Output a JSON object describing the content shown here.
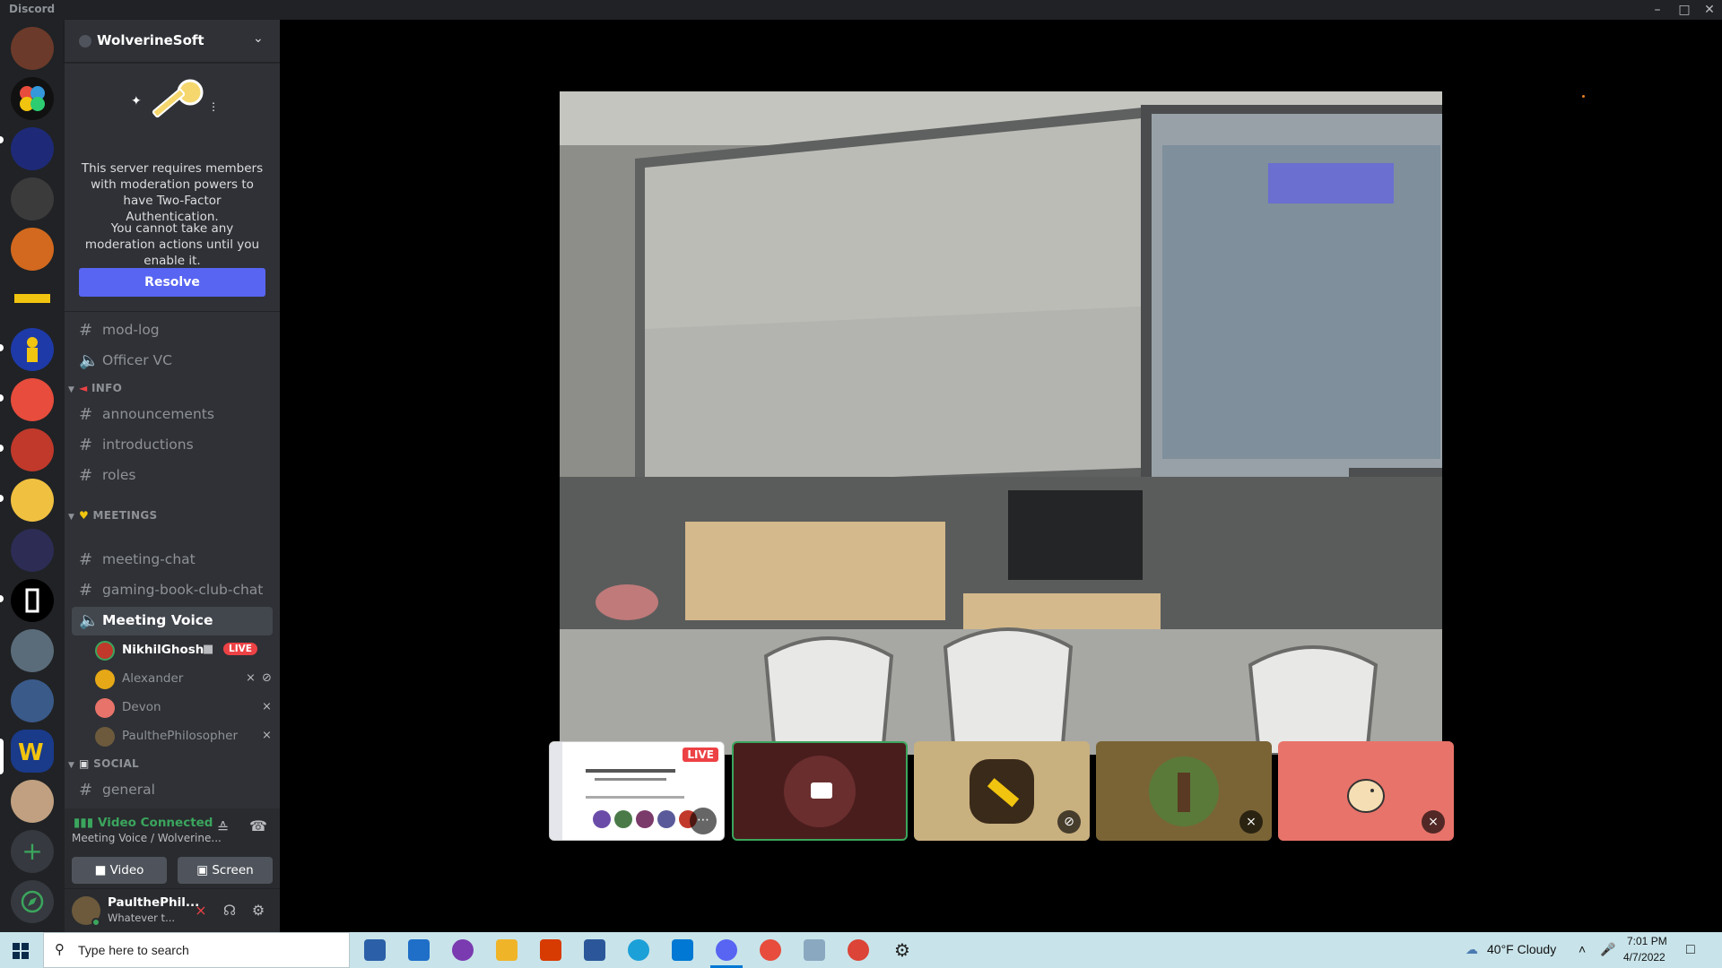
{
  "window": {
    "app_name": "Discord"
  },
  "server": {
    "name": "WolverineSoft",
    "notice": {
      "line1": "This server requires members with moderation powers to have Two-Factor Authentication.",
      "line2": "You cannot take any moderation actions until you enable it.",
      "resolve_label": "Resolve"
    }
  },
  "channels": {
    "top": [
      {
        "type": "text",
        "name": "mod-log"
      },
      {
        "type": "voice",
        "name": "Officer VC"
      }
    ],
    "info_category": "INFO",
    "info": [
      "announcements",
      "introductions",
      "roles"
    ],
    "meetings_category": "MEETINGS",
    "meetings": [
      "meeting-chat",
      "gaming-book-club-chat"
    ],
    "voice_active": "Meeting Voice",
    "social_category": "SOCIAL",
    "social": [
      "general"
    ]
  },
  "voice_users": [
    {
      "name": "NikhilGhosh",
      "live_label": "LIVE",
      "color": "#c0392b"
    },
    {
      "name": "Alexander",
      "color": "#e6a817"
    },
    {
      "name": "Devon",
      "color": "#e8736a"
    },
    {
      "name": "PaulthePhilosopher",
      "color": "#6d5a3c"
    }
  ],
  "voice_panel": {
    "status": "Video Connected",
    "location": "Meeting Voice / Wolverine...",
    "video_label": "Video",
    "screen_label": "Screen"
  },
  "user": {
    "name": "PaulthePhil...",
    "status": "Whatever t..."
  },
  "stream_tiles": [
    {
      "kind": "screen",
      "live_label": "LIVE",
      "bg": "#ffffff"
    },
    {
      "kind": "camera",
      "bg": "#4a1d1d"
    },
    {
      "kind": "avatar",
      "bg": "#c9b07f"
    },
    {
      "kind": "avatar",
      "bg": "#7a6436"
    },
    {
      "kind": "avatar",
      "bg": "#e8736a"
    }
  ],
  "taskbar": {
    "search_placeholder": "Type here to search",
    "weather": "40°F  Cloudy",
    "time": "7:01 PM",
    "date": "4/7/2022"
  }
}
